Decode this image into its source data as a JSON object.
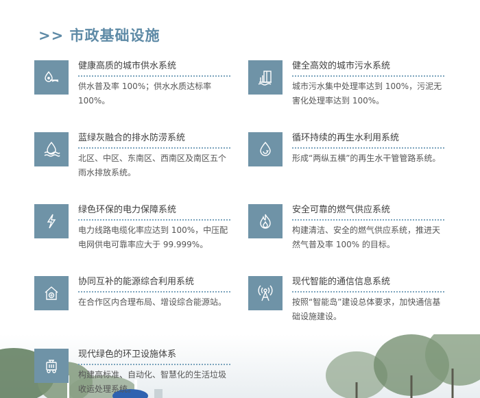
{
  "header": {
    "title": ">> 市政基础设施"
  },
  "items": [
    {
      "icon": "water-drop-icon",
      "title": "健康高质的城市供水系统",
      "desc": "供水普及率 100%；供水水质达标率 100%。"
    },
    {
      "icon": "sewage-icon",
      "title": "健全高效的城市污水系统",
      "desc": "城市污水集中处理率达到 100%，污泥无害化处理率达到 100%。"
    },
    {
      "icon": "flood-icon",
      "title": "蓝绿灰融合的排水防涝系统",
      "desc": "北区、中区、东南区、西南区及南区五个雨水排放系统。"
    },
    {
      "icon": "recycle-water-icon",
      "title": "循环持续的再生水利用系统",
      "desc": "形成“两纵五横”的再生水干管管路系统。"
    },
    {
      "icon": "lightning-icon",
      "title": "绿色环保的电力保障系统",
      "desc": "电力线路电缆化率应达到 100%，中压配电网供电可靠率应大于 99.999%。"
    },
    {
      "icon": "flame-icon",
      "title": "安全可靠的燃气供应系统",
      "desc": "构建清洁、安全的燃气供应系统，推进天然气普及率 100% 的目标。"
    },
    {
      "icon": "energy-house-icon",
      "title": "协同互补的能源综合利用系统",
      "desc": "在合作区内合理布局、增设综合能源站。"
    },
    {
      "icon": "signal-tower-icon",
      "title": "现代智能的通信信息系统",
      "desc": "按照“智能岛”建设总体要求，加快通信基础设施建设。"
    },
    {
      "icon": "garbage-truck-icon",
      "title": "现代绿色的环卫设施体系",
      "desc": "构建高标准、自动化、智慧化的生活垃圾收运处理系统。"
    }
  ]
}
